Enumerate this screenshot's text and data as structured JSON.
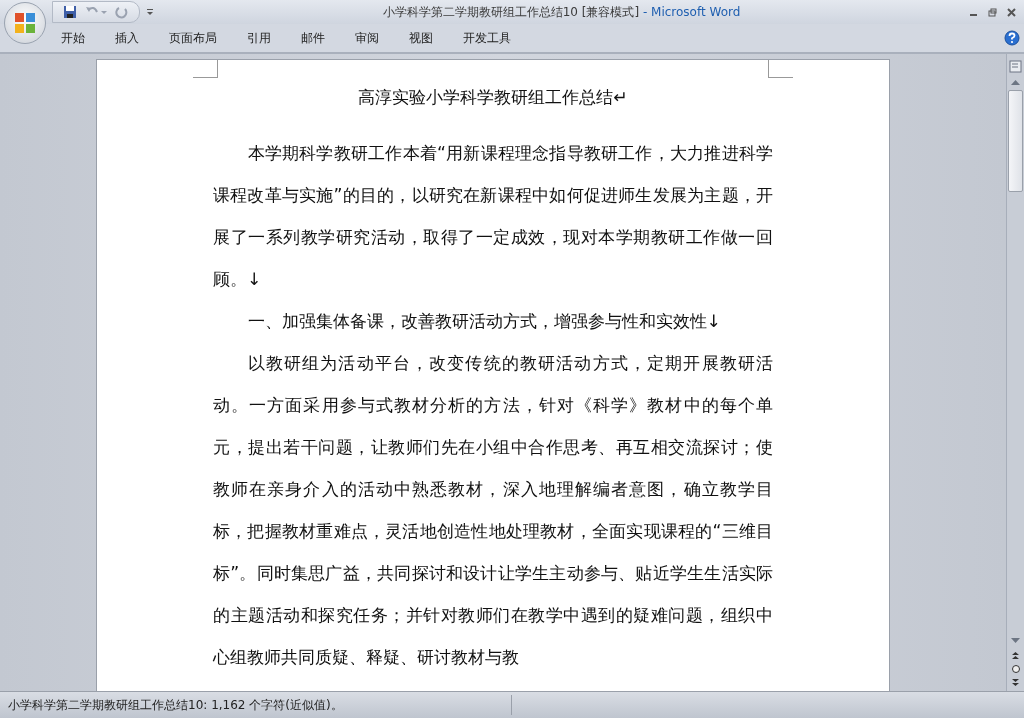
{
  "window": {
    "title": "小学科学第二学期教研组工作总结10 [兼容模式]",
    "app_name": "- Microsoft Word"
  },
  "ribbon_tabs": [
    {
      "label": "开始",
      "selected": false
    },
    {
      "label": "插入",
      "selected": false
    },
    {
      "label": "页面布局",
      "selected": false
    },
    {
      "label": "引用",
      "selected": false
    },
    {
      "label": "邮件",
      "selected": false
    },
    {
      "label": "审阅",
      "selected": false
    },
    {
      "label": "视图",
      "selected": false
    },
    {
      "label": "开发工具",
      "selected": false
    }
  ],
  "document": {
    "title": "高淳实验小学科学教研组工作总结↵",
    "paragraphs": [
      {
        "text": "本学期科学教研工作本着“用新课程理念指导教研工作，大力推进科学课程改革与实施”的目的，以研究在新课程中如何促进师生发展为主题，开展了一系列教学研究活动，取得了一定成效，现对本学期教研工作做一回顾。↓"
      },
      {
        "text": "一、加强集体备课，改善教研活动方式，增强参与性和实效性↓"
      },
      {
        "text": "以教研组为活动平台，改变传统的教研活动方式，定期开展教研活动。一方面采用参与式教材分析的方法，针对《科学》教材中的每个单元，提出若干问题，让教师们先在小组中合作思考、再互相交流探讨；使教师在亲身介入的活动中熟悉教材，深入地理解编者意图，确立教学目标，把握教材重难点，灵活地创造性地处理教材，全面实现课程的“三维目标”。同时集思广益，共同探讨和设计让学生主动参与、贴近学生生活实际的主题活动和探究任务；并针对教师们在教学中遇到的疑难问题，组织中心组教师共同质疑、释疑、研讨教材与教"
      }
    ]
  },
  "status_bar": {
    "text": "小学科学第二学期教研组工作总结10: 1,162 个字符(近似值)。"
  }
}
